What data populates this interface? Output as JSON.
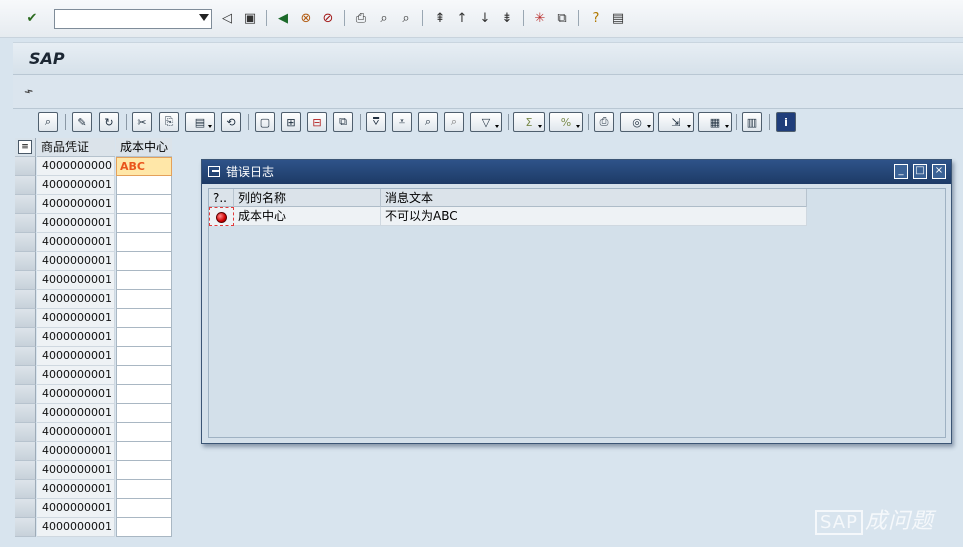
{
  "system_toolbar": {
    "command_field": {
      "value": "",
      "placeholder": ""
    },
    "icons": [
      "enter-icon",
      "back-icon",
      "save-icon",
      "back-nav-icon",
      "exit-icon",
      "cancel-icon",
      "print-icon",
      "find-icon",
      "find-next-icon",
      "first-page-icon",
      "prev-page-icon",
      "next-page-icon",
      "last-page-icon",
      "new-session-icon",
      "shortcut-icon",
      "help-icon",
      "layout-icon"
    ]
  },
  "header": {
    "title": "SAP"
  },
  "grid": {
    "columns": [
      "商品凭证",
      "成本中心"
    ],
    "rows": [
      {
        "doc": "4000000000",
        "cost_center": "ABC"
      },
      {
        "doc": "4000000001",
        "cost_center": ""
      },
      {
        "doc": "4000000001",
        "cost_center": ""
      },
      {
        "doc": "4000000001",
        "cost_center": ""
      },
      {
        "doc": "4000000001",
        "cost_center": ""
      },
      {
        "doc": "4000000001",
        "cost_center": ""
      },
      {
        "doc": "4000000001",
        "cost_center": ""
      },
      {
        "doc": "4000000001",
        "cost_center": ""
      },
      {
        "doc": "4000000001",
        "cost_center": ""
      },
      {
        "doc": "4000000001",
        "cost_center": ""
      },
      {
        "doc": "4000000001",
        "cost_center": ""
      },
      {
        "doc": "4000000001",
        "cost_center": ""
      },
      {
        "doc": "4000000001",
        "cost_center": ""
      },
      {
        "doc": "4000000001",
        "cost_center": ""
      },
      {
        "doc": "4000000001",
        "cost_center": ""
      },
      {
        "doc": "4000000001",
        "cost_center": ""
      },
      {
        "doc": "4000000001",
        "cost_center": ""
      },
      {
        "doc": "4000000001",
        "cost_center": ""
      },
      {
        "doc": "4000000001",
        "cost_center": ""
      },
      {
        "doc": "4000000001",
        "cost_center": ""
      }
    ]
  },
  "dialog": {
    "title": "错误日志",
    "columns": [
      "?..",
      "列的名称",
      "消息文本"
    ],
    "rows": [
      {
        "status": "error",
        "column_name": "成本中心",
        "message": "不可以为ABC"
      }
    ],
    "window_buttons": {
      "minimize": "_",
      "maximize": "□",
      "close": "×"
    }
  },
  "watermark": {
    "brand": "SAP",
    "text": "成问题"
  },
  "colors": {
    "title_bar": "#1d3a66",
    "error_cell_text": "#e9541c",
    "error_cell_bg": "#ffe7a8"
  }
}
